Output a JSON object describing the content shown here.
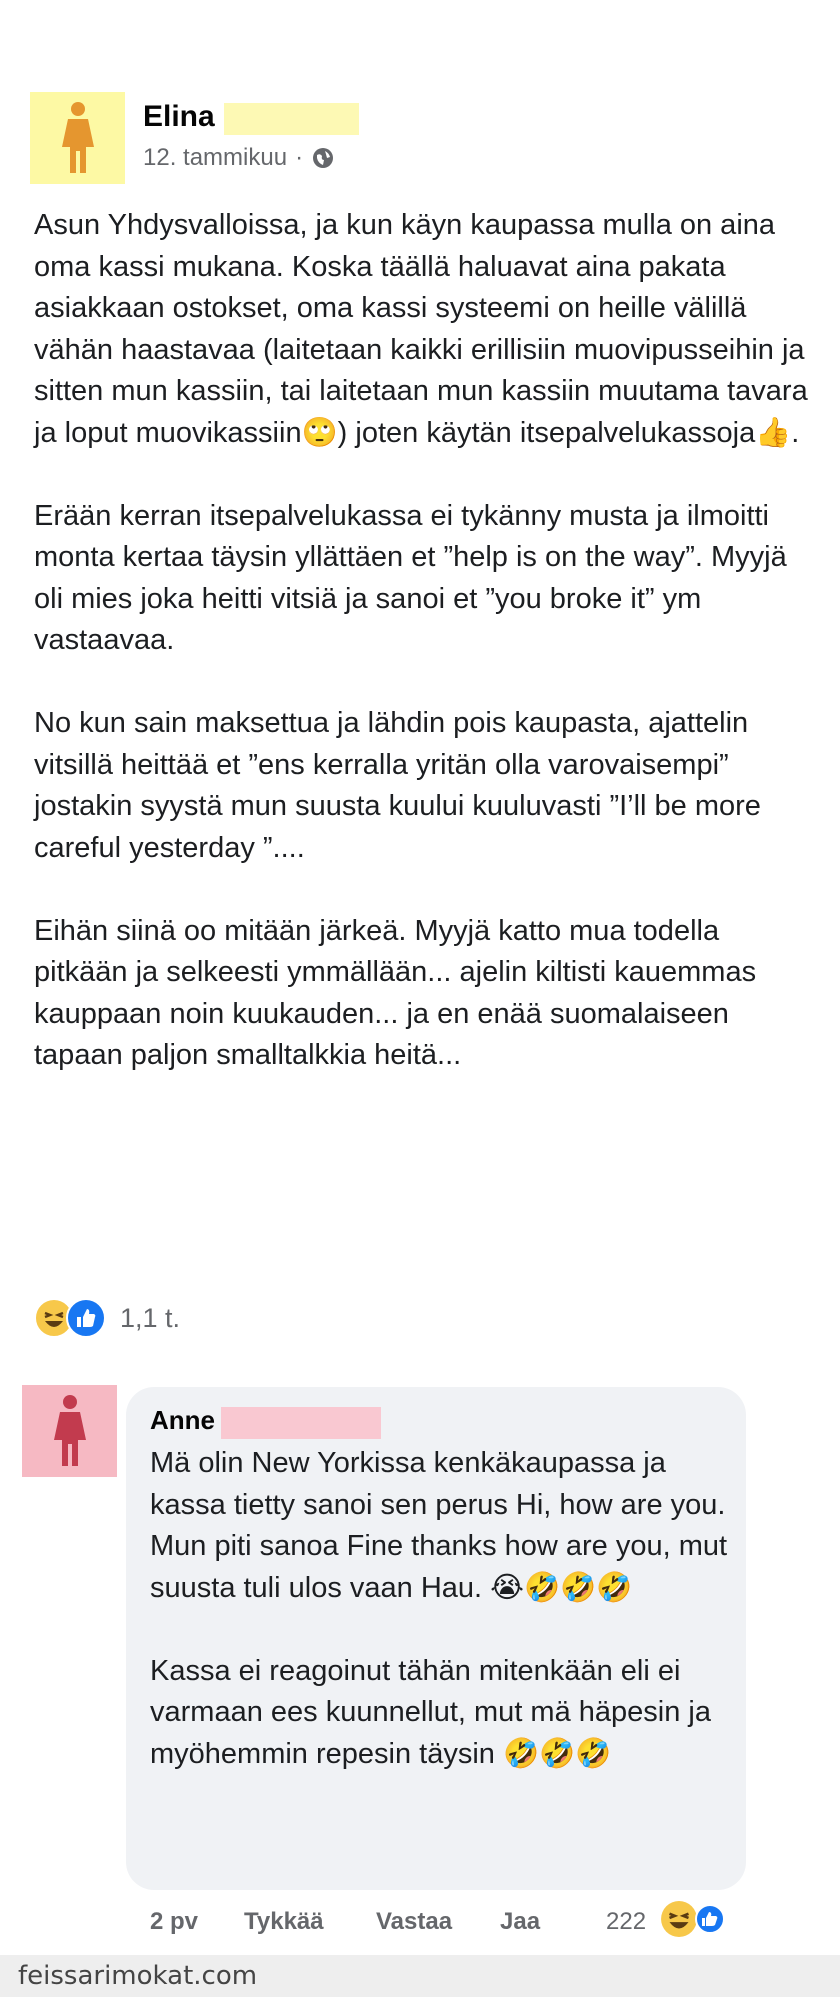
{
  "post": {
    "author": "Elina",
    "date": "12. tammikuu",
    "meta_separator": "·",
    "paragraphs": [
      "Asun Yhdysvalloissa, ja kun käyn kaupassa mulla on aina oma kassi mukana. Koska täällä haluavat aina pakata asiakkaan ostokset, oma kassi systeemi on heille välillä vähän haastavaa (laitetaan kaikki erillisiin muovipusseihin ja sitten mun kassiin, tai laitetaan mun kassiin muutama tavara ja loput muovikassiin🙄) joten käytän itsepalvelukassoja👍.",
      "Erään kerran itsepalvelukassa ei tykänny musta ja ilmoitti monta kertaa täysin yllättäen et ”help is on the way”. Myyjä oli mies joka heitti vitsiä ja sanoi et ”you broke it” ym vastaavaa.",
      "No kun sain maksettua ja lähdin pois kaupasta, ajattelin vitsillä heittää et ”ens kerralla yritän olla varovaisempi” jostakin syystä mun suusta kuului kuuluvasti ”I’ll be more careful yesterday ”....",
      "Eihän siinä oo mitään järkeä. Myyjä katto mua todella pitkään ja selkeesti ymmällään... ajelin kiltisti kauemmas kauppaan noin kuukauden... ja en enää suomalaiseen tapaan paljon smalltalkkia heitä..."
    ],
    "reaction_count": "1,1 t."
  },
  "comment": {
    "author": "Anne",
    "paragraphs": [
      "Mä olin New Yorkissa kenkäkaupassa ja kassa tietty sanoi sen perus Hi, how are you. Mun piti sanoa Fine thanks how are you, mut suusta tuli ulos vaan Hau. 😭🤣🤣🤣",
      "Kassa ei reagoinut tähän mitenkään eli ei varmaan ees kuunnellut, mut mä häpesin ja myöhemmin repesin täysin 🤣🤣🤣"
    ],
    "time": "2 pv",
    "like_label": "Tykkää",
    "reply_label": "Vastaa",
    "share_label": "Jaa",
    "reaction_count": "222"
  },
  "watermark": "feissarimokat.com",
  "colors": {
    "avatar_yellow": "#fdf9a4",
    "avatar_pink": "#f6b9c3",
    "like_blue": "#1877f2",
    "haha_yellow": "#f7c84a",
    "meta_gray": "#65676b"
  }
}
